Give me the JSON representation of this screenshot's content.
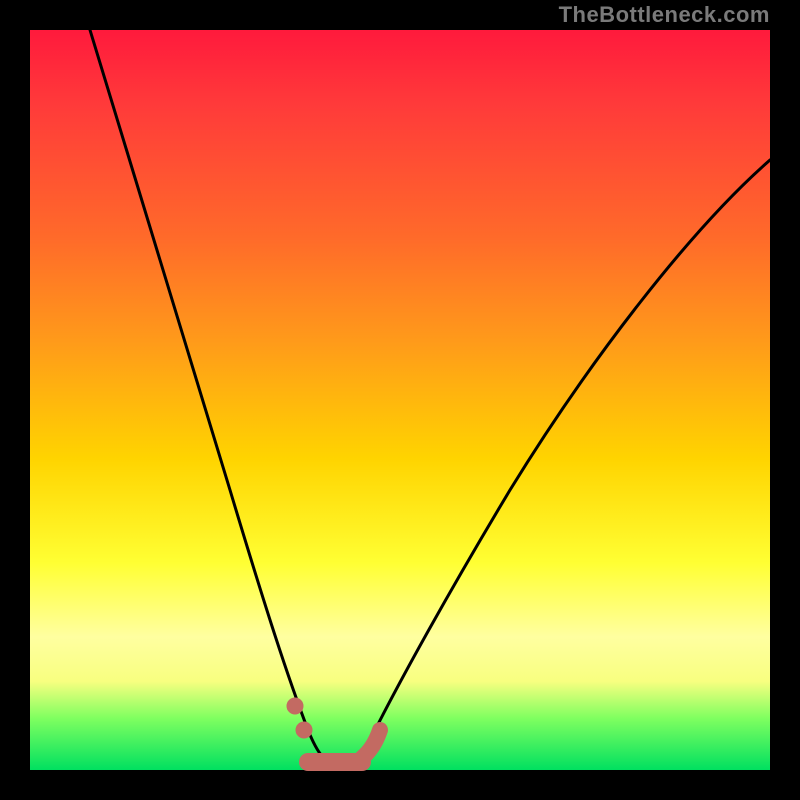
{
  "attribution": "TheBottleneck.com",
  "chart_data": {
    "type": "line",
    "title": "",
    "xlabel": "",
    "ylabel": "",
    "xlim": [
      0,
      100
    ],
    "ylim": [
      0,
      100
    ],
    "grid": false,
    "legend": false,
    "colors": {
      "curve_main": "#000000",
      "curve_highlight": "#c36a62",
      "gradient_top": "#ff1a3c",
      "gradient_bottom": "#00e060"
    },
    "series": [
      {
        "name": "bottleneck-curve",
        "x": [
          0,
          4,
          8,
          12,
          16,
          20,
          24,
          28,
          30,
          32,
          34,
          36,
          38,
          40,
          42,
          44,
          46,
          50,
          56,
          62,
          70,
          80,
          90,
          100
        ],
        "y": [
          100,
          92,
          83,
          73,
          63,
          52,
          40,
          27,
          20,
          14,
          8,
          4,
          1.5,
          0.5,
          0.5,
          1.5,
          4,
          12,
          24,
          36,
          50,
          65,
          76,
          82
        ]
      },
      {
        "name": "highlight-flat-region",
        "x": [
          33,
          35,
          37,
          39,
          41,
          43,
          45
        ],
        "y": [
          9,
          5,
          2,
          0.5,
          0.5,
          2,
          5
        ]
      }
    ]
  }
}
